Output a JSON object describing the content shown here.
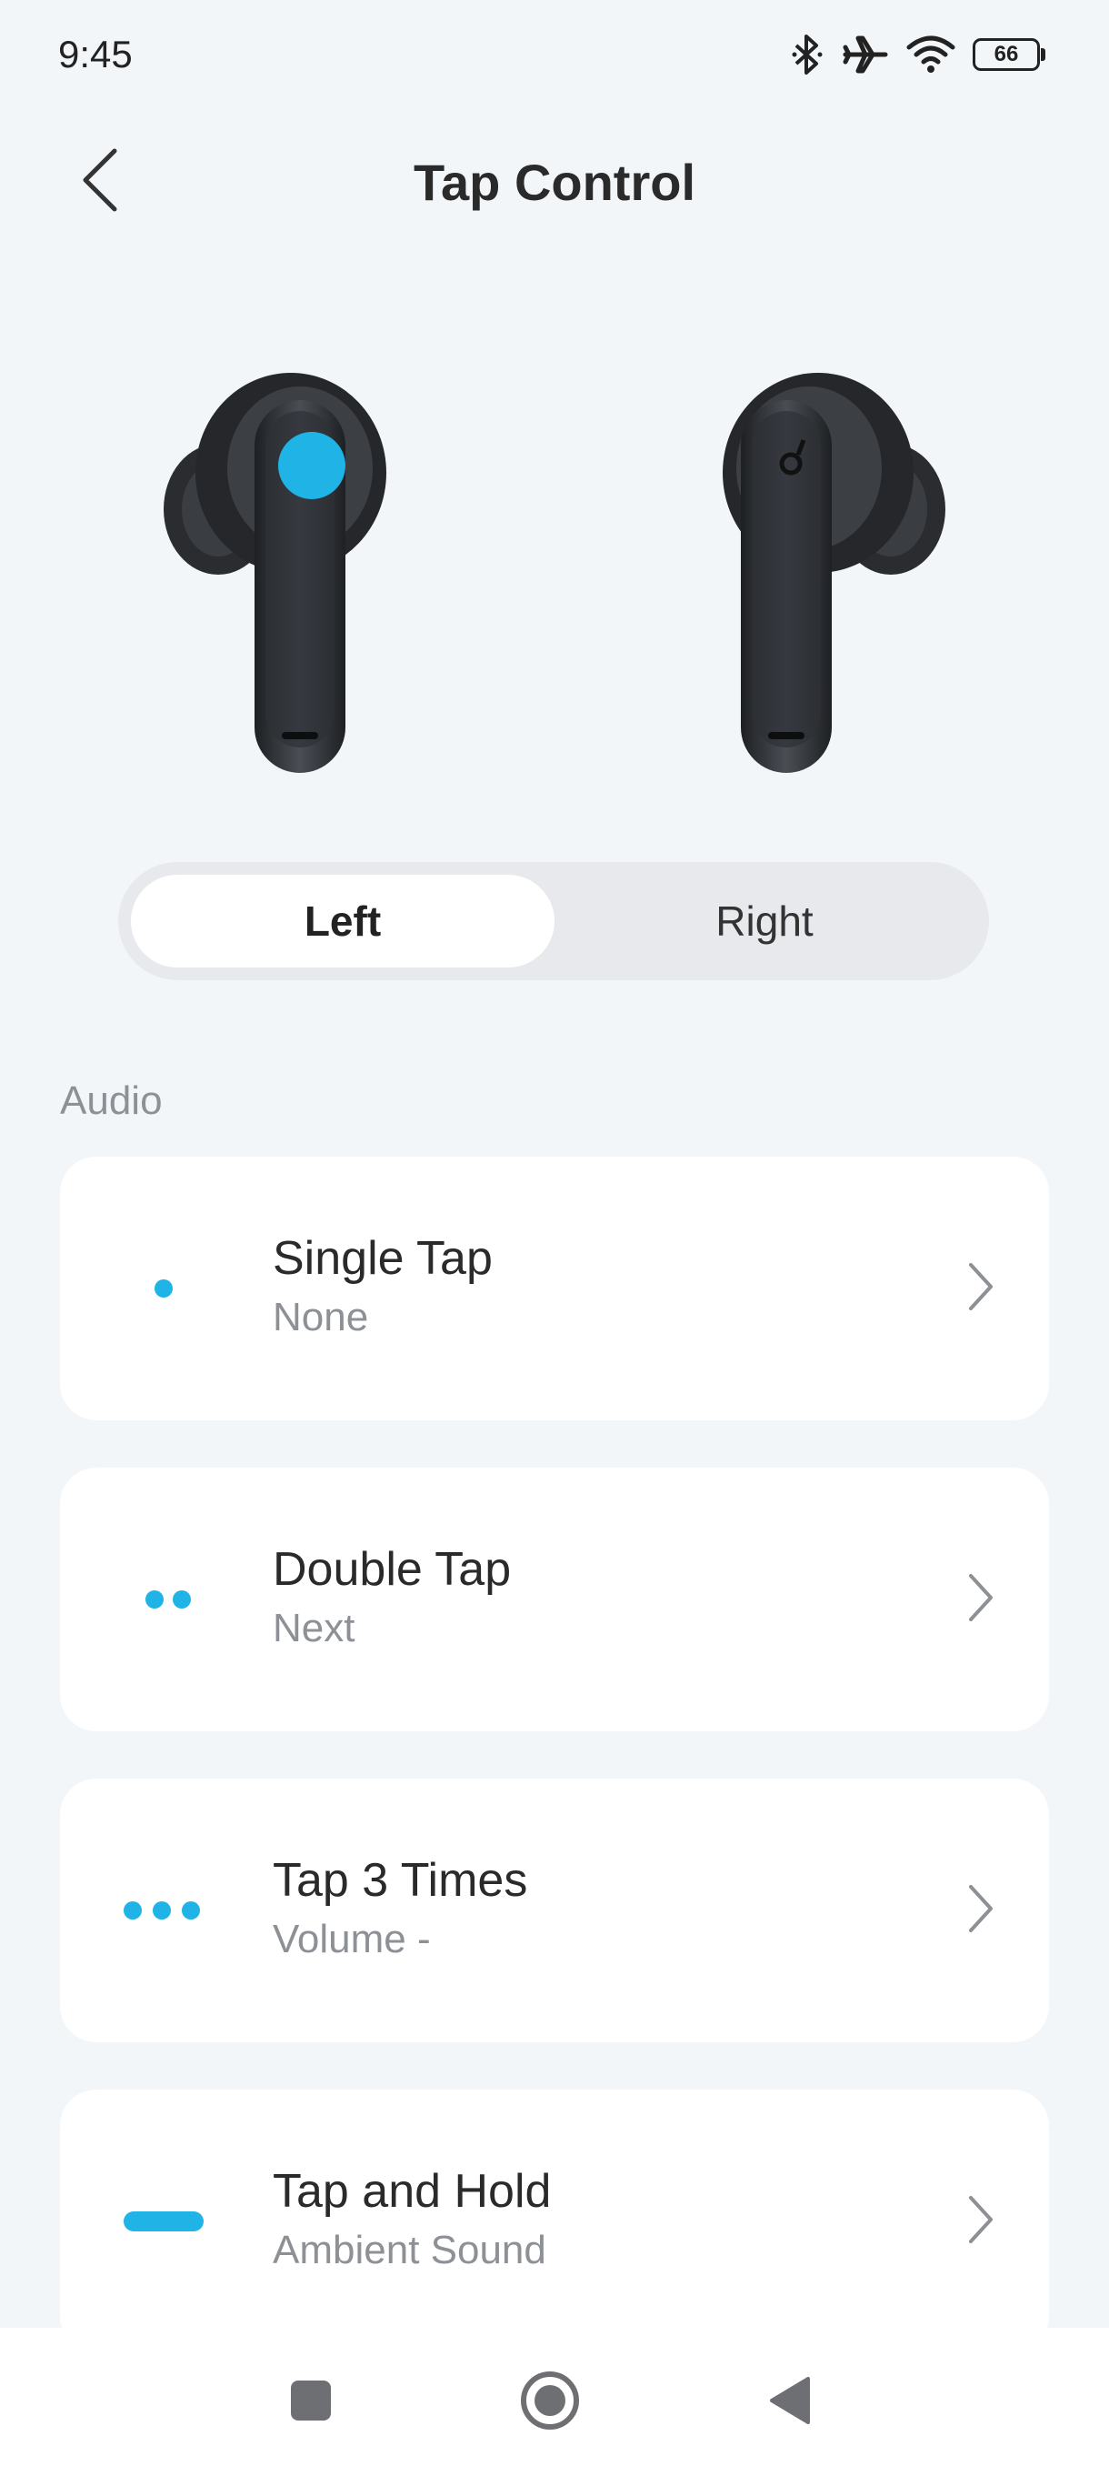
{
  "status_bar": {
    "time": "9:45",
    "battery": "66",
    "battery_level": 0.66,
    "icons": [
      "bluetooth-icon",
      "airplane-icon",
      "wifi-icon",
      "battery-icon"
    ]
  },
  "header": {
    "title": "Tap Control",
    "back_icon": "chevron-left-icon"
  },
  "segment": {
    "left_label": "Left",
    "right_label": "Right",
    "selected": "Left"
  },
  "section": {
    "label": "Audio"
  },
  "controls": [
    {
      "title": "Single Tap",
      "value": "None",
      "icon": "single-dot-icon"
    },
    {
      "title": "Double Tap",
      "value": "Next",
      "icon": "double-dot-icon"
    },
    {
      "title": "Tap 3 Times",
      "value": "Volume -",
      "icon": "triple-dot-icon"
    },
    {
      "title": "Tap and Hold",
      "value": "Ambient Sound",
      "icon": "dash-icon"
    }
  ],
  "colors": {
    "accent": "#1fb3e6",
    "background": "#f3f6f9",
    "card": "#ffffff",
    "secondary_text": "#8d9196"
  }
}
